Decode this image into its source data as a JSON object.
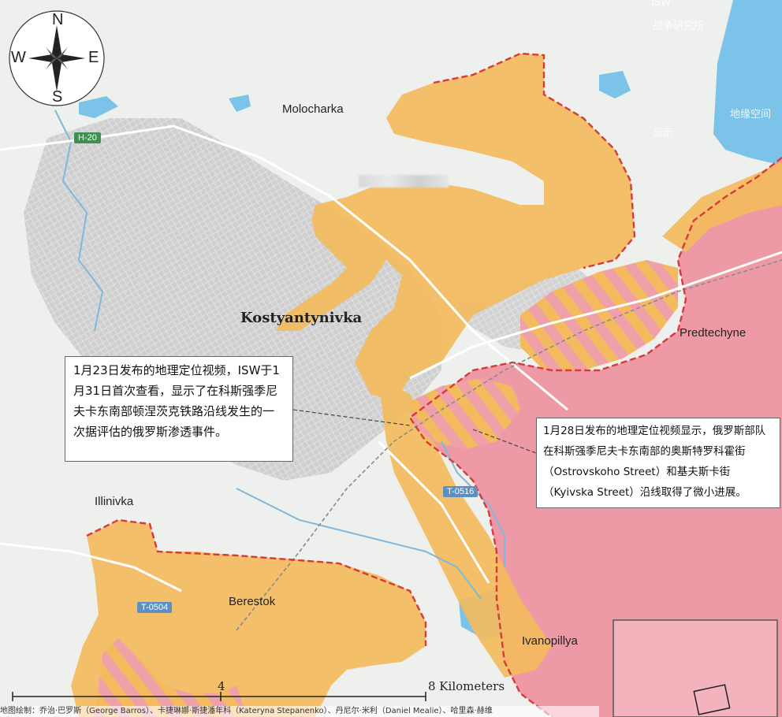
{
  "compass": {
    "n": "N",
    "s": "S",
    "e": "E",
    "w": "W"
  },
  "places": {
    "molocharka": "Molocharka",
    "kostyantynivka": "Kostyantynivka",
    "predtechyne": "Predtechyne",
    "illinivka": "Illinivka",
    "berestok": "Berestok",
    "ivanopillya": "Ivanopillya"
  },
  "roads": {
    "h20": "H-20",
    "t0516": "T-0516",
    "t0504": "T-0504"
  },
  "annotations": {
    "left": "1月23日发布的地理定位视频，ISW于1月31日首次查看，显示了在科斯强季尼夫卡东南部顿涅茨克铁路沿线发生的一次据评估的俄罗斯渗透事件。",
    "right": "1月28日发布的地理定位视频显示，俄罗斯部队在科斯强季尼夫卡东南部的奥斯特罗科霍街（Ostrovskoho Street）和基夫斯卡街（Kyivska Street）沿线取得了微小进展。"
  },
  "scale": {
    "mid": "4",
    "end": "8 Kilometers"
  },
  "credit": "地图绘制：乔治·巴罗斯（George Barros）、卡捷琳娜·斯捷潘年科（Kateryna Stepanenko）、丹尼尔·米利（Daniel Mealie）、哈里森·赫维",
  "header_fragments": {
    "isw": "ISW",
    "line1": "战争研究所",
    "line2": "地缘空间",
    "line3": "显示"
  },
  "colors": {
    "russian_controlled": "#ee9aa6",
    "russian_advance": "#f4bb5e",
    "infiltration_hatch": "#f0a0a8",
    "frontline": "#d63a3a",
    "water": "#7bc3e8",
    "urban": "#c9cac9"
  }
}
